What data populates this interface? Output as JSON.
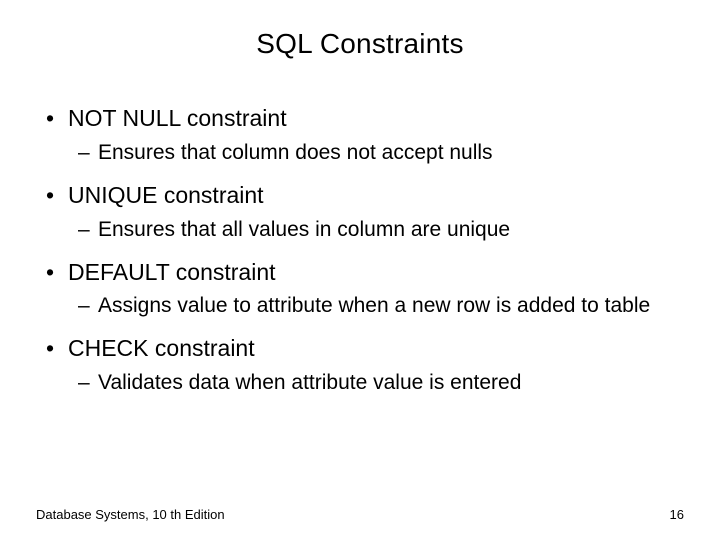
{
  "title": "SQL Constraints",
  "bullets": [
    {
      "label": "NOT NULL constraint",
      "sub": "Ensures that column does not accept nulls"
    },
    {
      "label": "UNIQUE constraint",
      "sub": "Ensures that all values in column are unique"
    },
    {
      "label": "DEFAULT constraint",
      "sub": "Assigns value to attribute when a new row is added to table"
    },
    {
      "label": "CHECK constraint",
      "sub": "Validates data when attribute value is entered"
    }
  ],
  "footer": {
    "left": "Database Systems, 10 th Edition",
    "right": "16"
  }
}
